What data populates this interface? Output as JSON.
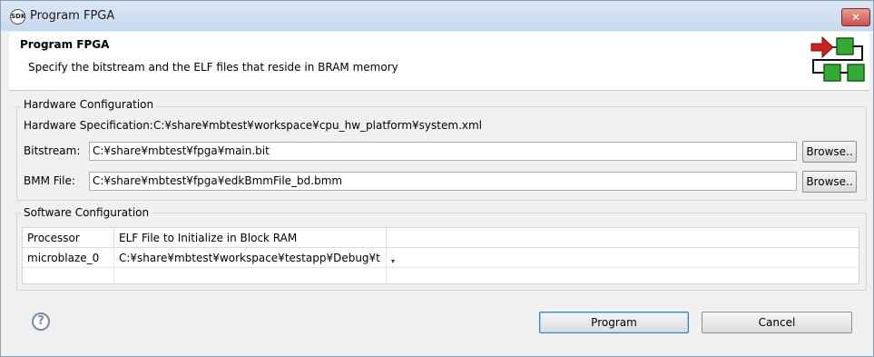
{
  "window": {
    "title": "Program FPGA",
    "title_icon_text": "SDK",
    "close_symbol": "✕"
  },
  "banner": {
    "title": "Program FPGA",
    "description": "Specify the bitstream and the ELF files that reside in BRAM memory",
    "graphic_icon": "fpga-program-icon"
  },
  "hardware": {
    "group_label": "Hardware Configuration",
    "spec_label": "Hardware Specification:",
    "spec_value": "C:¥share¥mbtest¥workspace¥cpu_hw_platform¥system.xml",
    "bitstream_label": "Bitstream:",
    "bitstream_value": "C:¥share¥mbtest¥fpga¥main.bit",
    "bmm_label": "BMM File:",
    "bmm_value": "C:¥share¥mbtest¥fpga¥edkBmmFile_bd.bmm",
    "browse_label": "Browse.."
  },
  "software": {
    "group_label": "Software Configuration",
    "columns": [
      "Processor",
      "ELF File to Initialize in Block RAM"
    ],
    "rows": [
      {
        "processor": "microblaze_0",
        "elf": "C:¥share¥mbtest¥workspace¥testapp¥Debug¥t"
      }
    ],
    "dropdown_symbol": "▾"
  },
  "footer": {
    "help_symbol": "?",
    "program_label": "Program",
    "cancel_label": "Cancel"
  },
  "colors": {
    "arrow": "#cc2222",
    "block": "#33aa33"
  }
}
